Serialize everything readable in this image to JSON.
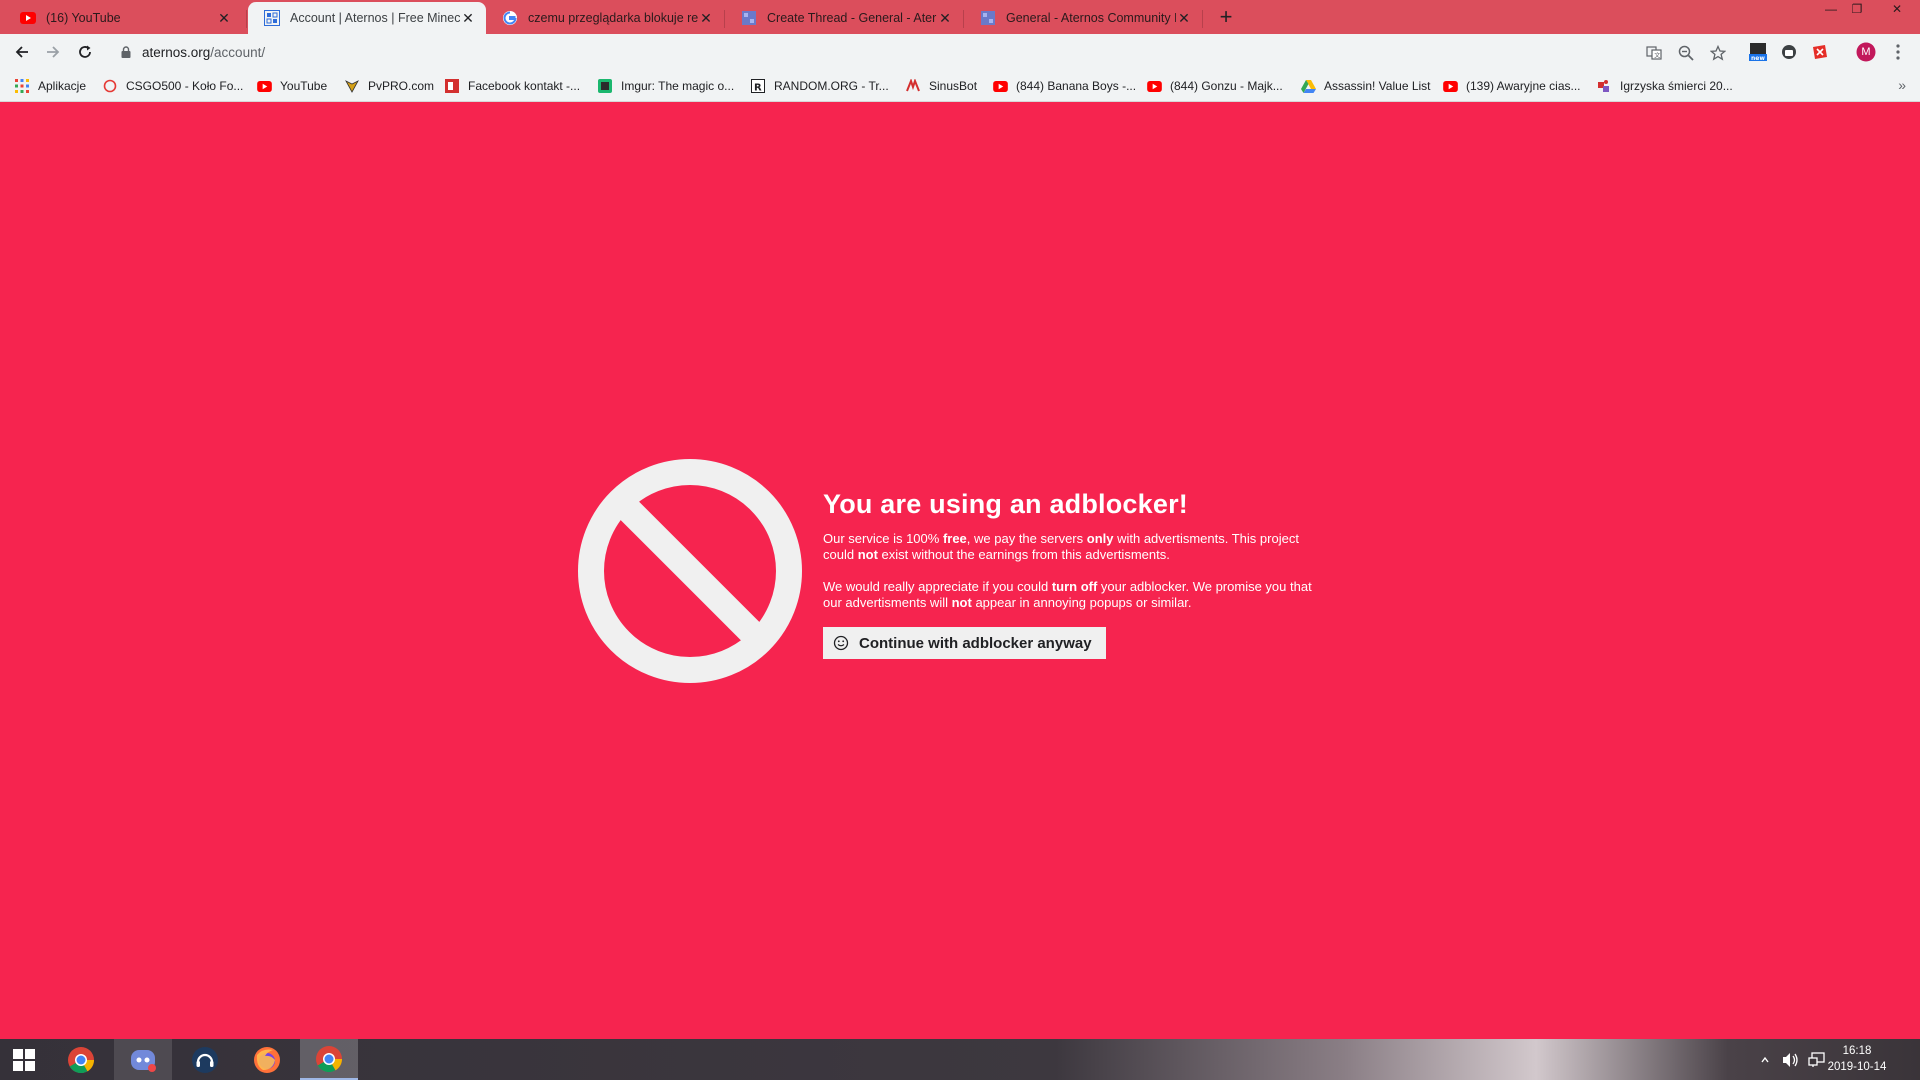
{
  "browser": {
    "tabs": [
      {
        "title": "(16) YouTube",
        "icon": "youtube-icon",
        "active": false
      },
      {
        "title": "Account | Aternos | Free Minecraft",
        "icon": "aternos-icon",
        "active": true
      },
      {
        "title": "czemu przeglądarka blokuje rekla",
        "icon": "google-icon",
        "active": false
      },
      {
        "title": "Create Thread - General - Aternos",
        "icon": "aternos-icon",
        "active": false
      },
      {
        "title": "General - Aternos Community Fo",
        "icon": "aternos-icon",
        "active": false
      }
    ],
    "url_host": "aternos.org",
    "url_path": "/account/",
    "bookmarks": [
      {
        "label": "Aplikacje",
        "icon": "apps-grid-icon"
      },
      {
        "label": "CSGO500 - Koło Fo...",
        "icon": "csgo500-icon"
      },
      {
        "label": "YouTube",
        "icon": "youtube-icon"
      },
      {
        "label": "PvPRO.com",
        "icon": "pvpro-icon"
      },
      {
        "label": "Facebook kontakt -...",
        "icon": "facebook-contact-icon"
      },
      {
        "label": "Imgur: The magic o...",
        "icon": "imgur-icon"
      },
      {
        "label": "RANDOM.ORG - Tr...",
        "icon": "random-org-icon"
      },
      {
        "label": "SinusBot",
        "icon": "sinusbot-icon"
      },
      {
        "label": "(844) Banana Boys -...",
        "icon": "youtube-icon"
      },
      {
        "label": "(844) Gonzu - Majk...",
        "icon": "youtube-icon"
      },
      {
        "label": "Assassin! Value List",
        "icon": "google-drive-icon"
      },
      {
        "label": "(139) Awaryjne cias...",
        "icon": "youtube-icon"
      },
      {
        "label": "Igrzyska śmierci 20...",
        "icon": "puzzle-icon"
      }
    ],
    "more_bookmarks": "»",
    "profile_initial": "M"
  },
  "page": {
    "headline": "You are using an adblocker!",
    "para1": {
      "t1": "Our service is 100% ",
      "b1": "free",
      "t2": ", we pay the servers ",
      "b2": "only",
      "t3": " with advertisments. This project could ",
      "b3": "not",
      "t4": " exist without the earnings from this advertisments."
    },
    "para2": {
      "t1": "We would really appreciate if you could ",
      "b1": "turn off",
      "t2": " your adblocker. We promise you that our advertisments will ",
      "b2": "not",
      "t3": " appear in annoying popups or similar."
    },
    "continue_label": "Continue with adblocker anyway"
  },
  "taskbar": {
    "apps": [
      "chrome-icon",
      "discord-icon",
      "teamspeak-icon",
      "firefox-icon",
      "chrome-icon"
    ],
    "time": "16:18",
    "date": "2019-10-14"
  },
  "colors": {
    "page_background": "#f6244f",
    "titlebar": "#db4e5c",
    "toolbar": "#f1f3f4"
  }
}
